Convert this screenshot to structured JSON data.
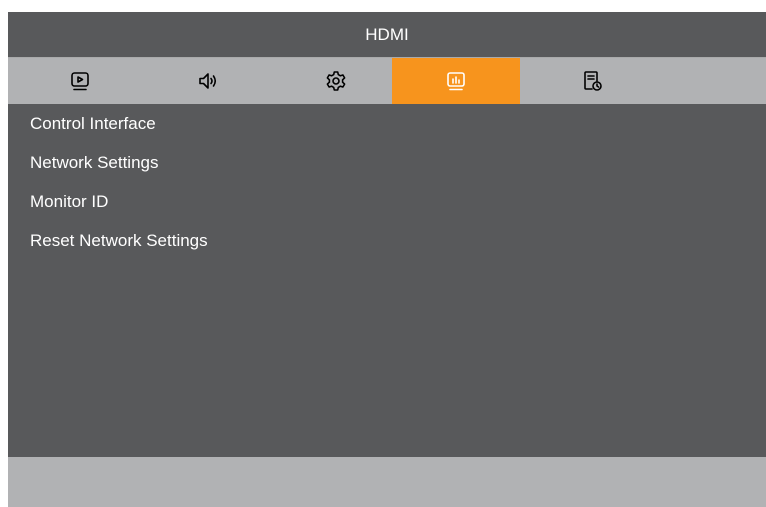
{
  "header": {
    "title": "HDMI"
  },
  "tabs": [
    {
      "icon": "picture-icon",
      "active": false
    },
    {
      "icon": "speaker-icon",
      "active": false
    },
    {
      "icon": "gear-icon",
      "active": false
    },
    {
      "icon": "monitor-chart-icon",
      "active": true
    },
    {
      "icon": "document-clock-icon",
      "active": false
    }
  ],
  "menu": {
    "items": [
      {
        "label": "Control Interface"
      },
      {
        "label": "Network Settings"
      },
      {
        "label": "Monitor ID"
      },
      {
        "label": "Reset Network Settings"
      }
    ]
  },
  "colors": {
    "panel": "#58595b",
    "tab_bar": "#b1b2b4",
    "accent": "#f7941d",
    "text": "#ffffff"
  }
}
